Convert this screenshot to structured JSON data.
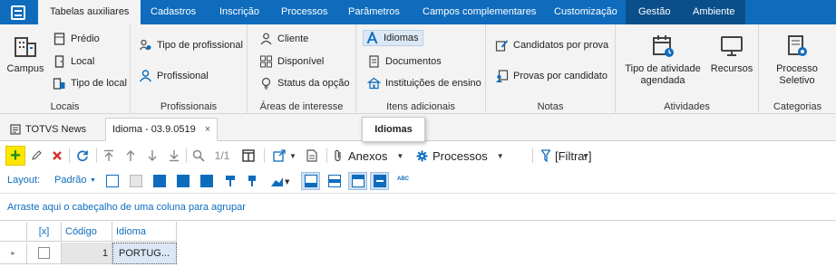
{
  "topbar": {
    "tabs": [
      "Tabelas auxiliares",
      "Cadastros",
      "Inscrição",
      "Processos",
      "Parâmetros",
      "Campos complementares",
      "Customização",
      "Gestão",
      "Ambiente"
    ]
  },
  "ribbon": {
    "locais": {
      "caption": "Locais",
      "campus": "Campus",
      "predio": "Prédio",
      "local": "Local",
      "tipo_local": "Tipo de local"
    },
    "profissionais": {
      "caption": "Profissionais",
      "tipo_profissional": "Tipo de profissional",
      "profissional": "Profissional"
    },
    "areas": {
      "caption": "Áreas de interesse",
      "cliente": "Cliente",
      "disponivel": "Disponível",
      "status_opcao": "Status da opção"
    },
    "itens": {
      "caption": "Itens adicionais",
      "idiomas": "Idiomas",
      "documentos": "Documentos",
      "instituicoes": "Instituições de ensino"
    },
    "notas": {
      "caption": "Notas",
      "candidatos_prova": "Candidatos por prova",
      "provas_candidato": "Provas por candidato"
    },
    "atividades": {
      "caption": "Atividades",
      "tipo_atividade_1": "Tipo de atividade",
      "tipo_atividade_2": "agendada",
      "recursos": "Recursos"
    },
    "categorias": {
      "caption": "Categorias",
      "processo_1": "Processo",
      "processo_2": "Seletivo"
    }
  },
  "doctabs": {
    "news": "TOTVS News",
    "idioma": "Idioma - 03.9.0519",
    "close": "×"
  },
  "tooltip": "Idiomas",
  "toolbar": {
    "page": "1/1",
    "anexos": "Anexos",
    "processos": "Processos",
    "filtrar": "[Filtrar]",
    "abc": "ABC"
  },
  "layout": {
    "label": "Layout:",
    "value": "Padrão"
  },
  "grouppanel": "Arraste aqui o cabeçalho de uma coluna para agrupar",
  "grid": {
    "headers": [
      "[x]",
      "Código",
      "Idioma"
    ],
    "rows": [
      {
        "codigo": "1",
        "idioma": "PORTUG..."
      }
    ]
  },
  "colors": {
    "accent": "#0f6cbd",
    "add": "#ffe600",
    "delete": "#d32f2f"
  }
}
